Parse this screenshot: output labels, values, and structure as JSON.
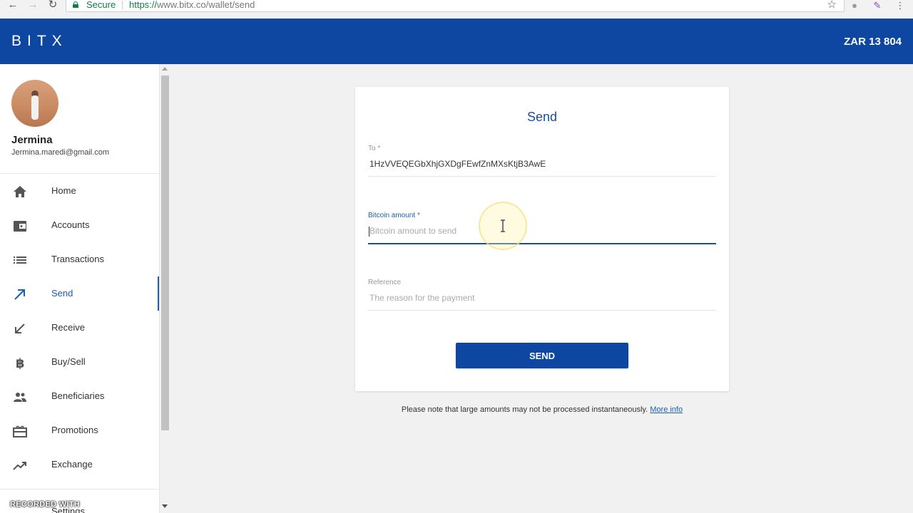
{
  "browser": {
    "secure_label": "Secure",
    "url_prefix": "https://",
    "url_host": "www.bitx.co",
    "url_path": "/wallet/send"
  },
  "header": {
    "logo": "BITX",
    "balance": "ZAR 13 804",
    "color": "#0d47a1"
  },
  "profile": {
    "name": "Jermina",
    "email": "Jermina.maredi@gmail.com"
  },
  "sidebar": {
    "items": [
      {
        "label": "Home",
        "icon": "home-icon"
      },
      {
        "label": "Accounts",
        "icon": "wallet-icon"
      },
      {
        "label": "Transactions",
        "icon": "list-icon"
      },
      {
        "label": "Send",
        "icon": "arrow-up-right-icon",
        "active": true
      },
      {
        "label": "Receive",
        "icon": "arrow-down-left-icon"
      },
      {
        "label": "Buy/Sell",
        "icon": "bitcoin-icon"
      },
      {
        "label": "Beneficiaries",
        "icon": "people-icon"
      },
      {
        "label": "Promotions",
        "icon": "gift-icon"
      },
      {
        "label": "Exchange",
        "icon": "trending-up-icon"
      }
    ],
    "settings_label": "Settings"
  },
  "send_form": {
    "title": "Send",
    "to_label": "To",
    "to_value": "1HzVVEQEGbXhjGXDgFEwfZnMXsKtjB3AwE",
    "amount_label": "Bitcoin amount",
    "amount_placeholder": "Bitcoin amount to send",
    "reference_label": "Reference",
    "reference_placeholder": "The reason for the payment",
    "required_mark": "*",
    "submit_label": "SEND"
  },
  "note": {
    "text": "Please note that large amounts may not be processed instantaneously.",
    "link": "More info"
  },
  "watermark": "RECORDED WITH"
}
